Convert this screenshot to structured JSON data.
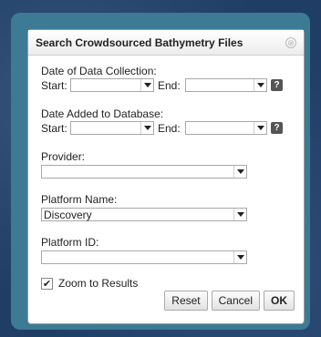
{
  "dialog": {
    "title": "Search Crowdsourced Bathymetry Files",
    "close_glyph": "⊗"
  },
  "collection": {
    "heading": "Date of Data Collection:",
    "start_label": "Start:",
    "start_value": "",
    "end_label": "End:",
    "end_value": "",
    "help_glyph": "?"
  },
  "added": {
    "heading": "Date Added to Database:",
    "start_label": "Start:",
    "start_value": "",
    "end_label": "End:",
    "end_value": "",
    "help_glyph": "?"
  },
  "provider": {
    "label": "Provider:",
    "value": ""
  },
  "platform_name": {
    "label": "Platform Name:",
    "value": "Discovery"
  },
  "platform_id": {
    "label": "Platform ID:",
    "value": ""
  },
  "zoom": {
    "label": "Zoom to Results",
    "checked": true,
    "check_glyph": "✔"
  },
  "buttons": {
    "reset": "Reset",
    "cancel": "Cancel",
    "ok": "OK"
  }
}
